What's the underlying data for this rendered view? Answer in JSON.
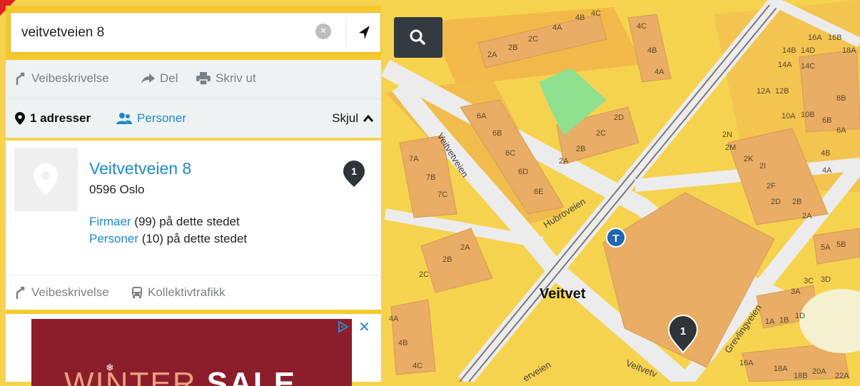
{
  "search": {
    "value": "veitvetveien 8",
    "clear_icon": "clear-icon",
    "locate_icon": "location-arrow-icon",
    "search_icon": "search-icon"
  },
  "toolbar": {
    "directions": "Veibeskrivelse",
    "share": "Del",
    "print": "Skriv ut"
  },
  "tabs": {
    "addresses": "1 adresser",
    "persons": "Personer",
    "hide": "Skjul"
  },
  "result": {
    "title": "Veitvetveien 8",
    "city": "0596 Oslo",
    "companies_link": "Firmaer",
    "companies_text": "(99) på dette stedet",
    "persons_link": "Personer",
    "persons_text": "(10) på dette stedet",
    "badge": "1",
    "directions": "Veibeskrivelse",
    "transit": "Kollektivtrafikk"
  },
  "ad": {
    "text_thin": "WINTER",
    "text_bold": "SALE",
    "close": "✕"
  },
  "map": {
    "place_label": "Veitvet",
    "metro_label": "T",
    "pin_label": "1",
    "streets": {
      "veitvetveien": "Veitvetveien",
      "hubroveien": "Hubroveien",
      "grevlingveien": "Grevlingveien",
      "veitvetv_bottom": "Veitvetv",
      "erveien": "erveien",
      "veien_left": "rveien"
    },
    "house_numbers": [
      "4A",
      "4B",
      "4C",
      "2A",
      "2B",
      "2C",
      "4C",
      "4B",
      "4A",
      "6A",
      "6B",
      "6C",
      "6D",
      "6E",
      "2D",
      "2C",
      "2B",
      "2A",
      "7A",
      "7B",
      "7C",
      "2A",
      "2B",
      "2C",
      "4A",
      "4B",
      "4C",
      "16A",
      "16B",
      "14B",
      "14D",
      "18A",
      "14A",
      "14C",
      "12A",
      "12B",
      "8B",
      "10A",
      "10B",
      "6B",
      "6A",
      "2N",
      "2M",
      "2K",
      "2I",
      "2F",
      "2D",
      "2B",
      "2A",
      "4B",
      "4A",
      "5A",
      "5B",
      "3C",
      "3D",
      "3A",
      "1A",
      "1B",
      "1D",
      "16A",
      "18A",
      "18B",
      "20A",
      "22A"
    ]
  },
  "colors": {
    "map_bg": "#f5d34f",
    "accent_blue": "#1d8ac7",
    "search_btn": "#333a40",
    "building": "#e9ad66",
    "road": "#ececec"
  }
}
